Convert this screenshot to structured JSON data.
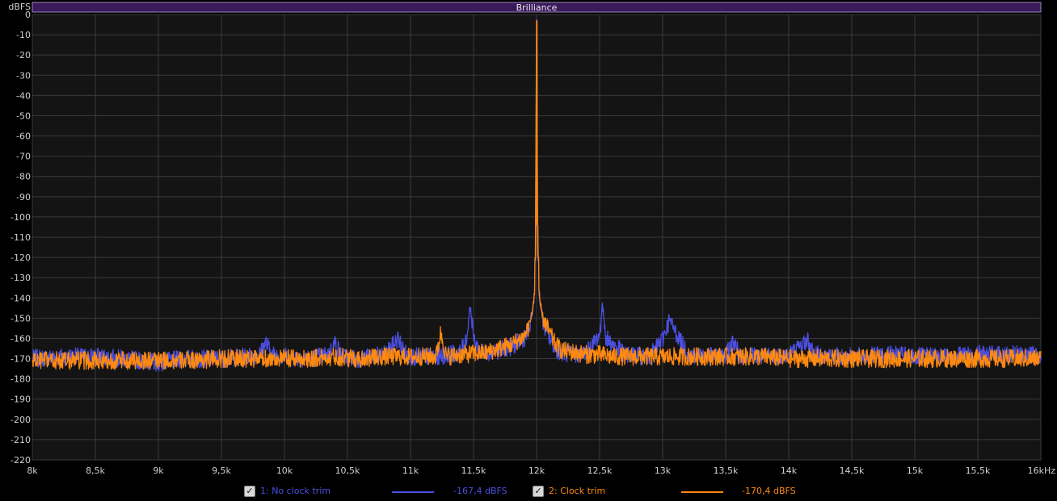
{
  "colors": {
    "background": "#000000",
    "plot_background": "#141414",
    "grid": "#3a3a3a",
    "band": "#3b1a5c",
    "series1": "#4b4fe0",
    "series2": "#ff8a10"
  },
  "chart_data": {
    "type": "line",
    "ylabel": "dBFS",
    "xunit": "kHz",
    "xlim": [
      8000,
      16000
    ],
    "ylim": [
      -220,
      0
    ],
    "grid": true,
    "band": {
      "label": "Brilliance"
    },
    "x_ticks": [
      {
        "v": 8000,
        "label": "8k"
      },
      {
        "v": 8500,
        "label": "8,5k"
      },
      {
        "v": 9000,
        "label": "9k"
      },
      {
        "v": 9500,
        "label": "9,5k"
      },
      {
        "v": 10000,
        "label": "10k"
      },
      {
        "v": 10500,
        "label": "10,5k"
      },
      {
        "v": 11000,
        "label": "11k"
      },
      {
        "v": 11500,
        "label": "11,5k"
      },
      {
        "v": 12000,
        "label": "12k"
      },
      {
        "v": 12500,
        "label": "12,5k"
      },
      {
        "v": 13000,
        "label": "13k"
      },
      {
        "v": 13500,
        "label": "13,5k"
      },
      {
        "v": 14000,
        "label": "14k"
      },
      {
        "v": 14500,
        "label": "14,5k"
      },
      {
        "v": 15000,
        "label": "15k"
      },
      {
        "v": 15500,
        "label": "15,5k"
      },
      {
        "v": 16000,
        "label": "16kHz"
      }
    ],
    "y_ticks": [
      0,
      -10,
      -20,
      -30,
      -40,
      -50,
      -60,
      -70,
      -80,
      -90,
      -100,
      -110,
      -120,
      -130,
      -140,
      -150,
      -160,
      -170,
      -180,
      -190,
      -200,
      -210,
      -220
    ],
    "series": [
      {
        "name": "1: No clock trim",
        "color": "#4b4fe0",
        "readout": "-167,4 dBFS",
        "x": [
          8000,
          8300,
          8500,
          8700,
          8900,
          9000,
          9200,
          9500,
          9700,
          9800,
          9850,
          9900,
          10000,
          10200,
          10350,
          10400,
          10450,
          10600,
          10800,
          10900,
          10950,
          11000,
          11200,
          11400,
          11450,
          11470,
          11500,
          11550,
          11700,
          11800,
          11900,
          11950,
          11980,
          11995,
          12000,
          12005,
          12020,
          12050,
          12100,
          12150,
          12200,
          12300,
          12400,
          12500,
          12520,
          12550,
          12700,
          12900,
          13000,
          13050,
          13200,
          13400,
          13500,
          13560,
          13600,
          13800,
          14000,
          14150,
          14200,
          14400,
          14600,
          14800,
          15000,
          15200,
          15400,
          15600,
          15800,
          16000
        ],
        "y": [
          -170,
          -169,
          -169,
          -170,
          -171,
          -172,
          -170,
          -170,
          -169,
          -168,
          -162,
          -168,
          -169,
          -170,
          -168,
          -162,
          -169,
          -170,
          -168,
          -160,
          -167,
          -169,
          -169,
          -167,
          -158,
          -143,
          -160,
          -167,
          -166,
          -164,
          -160,
          -154,
          -140,
          -100,
          -3,
          -100,
          -140,
          -152,
          -160,
          -165,
          -167,
          -168,
          -167,
          -158,
          -143,
          -160,
          -168,
          -169,
          -160,
          -151,
          -168,
          -169,
          -169,
          -161,
          -168,
          -169,
          -168,
          -161,
          -168,
          -169,
          -169,
          -168,
          -169,
          -169,
          -168,
          -168,
          -168,
          -168
        ]
      },
      {
        "name": "2: Clock trim",
        "color": "#ff8a10",
        "readout": "-170,4 dBFS",
        "x": [
          8000,
          8300,
          8500,
          8700,
          8900,
          9000,
          9200,
          9500,
          9700,
          9800,
          10000,
          10200,
          10400,
          10600,
          10800,
          11000,
          11200,
          11240,
          11280,
          11400,
          11600,
          11700,
          11800,
          11900,
          11950,
          11980,
          11995,
          12000,
          12005,
          12020,
          12050,
          12100,
          12150,
          12200,
          12300,
          12400,
          12500,
          12600,
          12700,
          12900,
          13000,
          13200,
          13400,
          13600,
          13800,
          14000,
          14200,
          14400,
          14600,
          14800,
          15000,
          15200,
          15400,
          15600,
          15800,
          16000
        ],
        "y": [
          -171,
          -171,
          -171,
          -171,
          -171,
          -171,
          -171,
          -170,
          -170,
          -170,
          -170,
          -170,
          -169,
          -170,
          -169,
          -169,
          -169,
          -157,
          -169,
          -168,
          -167,
          -165,
          -163,
          -159,
          -152,
          -140,
          -100,
          -3,
          -100,
          -140,
          -150,
          -157,
          -163,
          -166,
          -167,
          -168,
          -168,
          -169,
          -169,
          -169,
          -169,
          -169,
          -169,
          -169,
          -169,
          -170,
          -170,
          -170,
          -170,
          -170,
          -170,
          -170,
          -170,
          -170,
          -170,
          -170
        ]
      }
    ]
  },
  "legend": [
    {
      "label": "1: No clock trim",
      "readout": "-167,4 dBFS",
      "checked": true
    },
    {
      "label": "2: Clock trim",
      "readout": "-170,4 dBFS",
      "checked": true
    }
  ]
}
